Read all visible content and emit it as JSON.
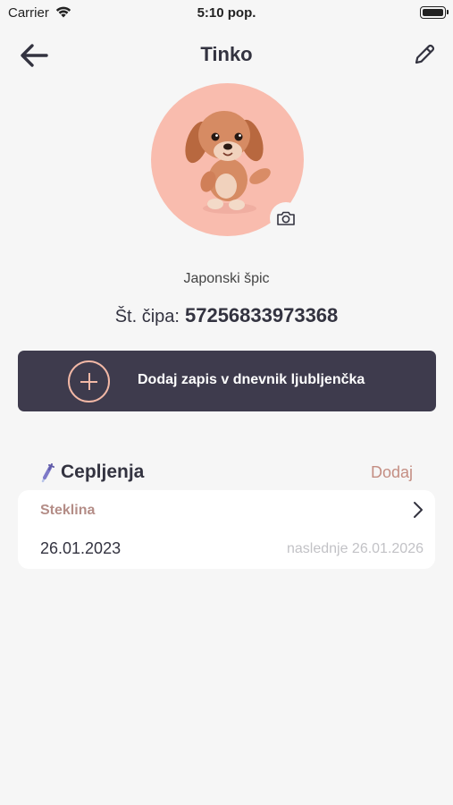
{
  "status_bar": {
    "carrier": "Carrier",
    "time": "5:10 pop."
  },
  "header": {
    "title": "Tinko",
    "back_icon": "arrow-left-icon",
    "edit_icon": "pencil-icon"
  },
  "pet": {
    "breed": "Japonski špic",
    "chip_label": "Št. čipa:",
    "chip_number": "57256833973368",
    "avatar_color": "#f9bcae"
  },
  "actions": {
    "add_entry_label": "Dodaj zapis v dnevnik ljubljenčka",
    "button_color": "#3e3b4d",
    "accent_color": "#f2b8a6"
  },
  "vaccinations": {
    "title": "Cepljenja",
    "add_label": "Dodaj",
    "items": [
      {
        "name": "Steklina",
        "date": "26.01.2023",
        "next": "naslednje 26.01.2026"
      }
    ]
  }
}
